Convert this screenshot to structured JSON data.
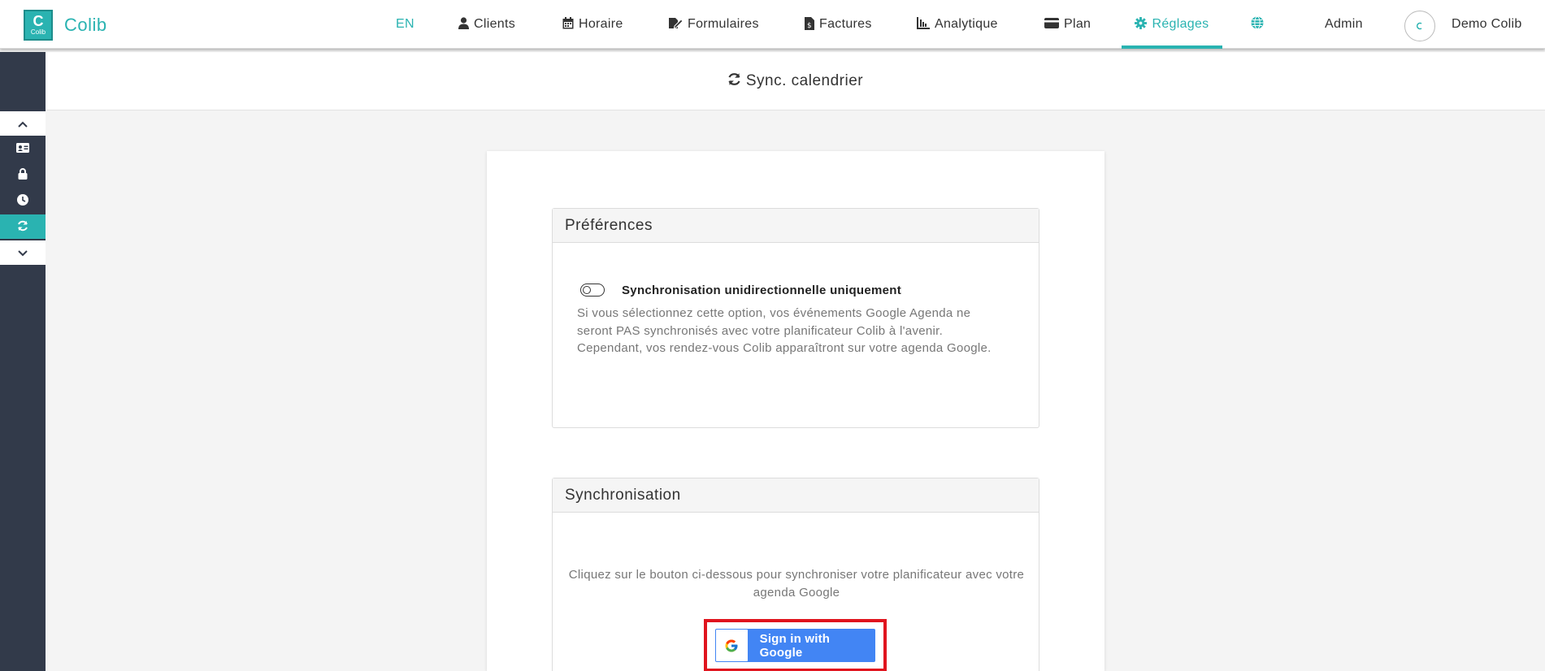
{
  "brand": {
    "logo_letter": "C",
    "logo_word": "Colib",
    "name": "Colib"
  },
  "nav": {
    "language": "EN",
    "items": [
      {
        "label": "Clients",
        "icon": "user-icon"
      },
      {
        "label": "Horaire",
        "icon": "calendar-icon"
      },
      {
        "label": "Formulaires",
        "icon": "form-edit-icon"
      },
      {
        "label": "Factures",
        "icon": "invoice-icon"
      },
      {
        "label": "Analytique",
        "icon": "chart-icon"
      },
      {
        "label": "Plan",
        "icon": "credit-card-icon"
      },
      {
        "label": "Réglages",
        "icon": "gear-icon",
        "active": true
      }
    ],
    "globe_icon": "globe-icon",
    "admin": "Admin",
    "user_name": "Demo Colib"
  },
  "sidebar": {
    "items": [
      "chevron-up-icon",
      "id-card-icon",
      "lock-icon",
      "clock-icon",
      "sync-icon",
      "chevron-down-icon"
    ],
    "active": "sync-icon"
  },
  "page": {
    "title": "Sync. calendrier",
    "title_icon": "sync-icon"
  },
  "preferences": {
    "heading": "Préférences",
    "toggle_label": "Synchronisation unidirectionnelle uniquement",
    "toggle_on": false,
    "description": "Si vous sélectionnez cette option, vos événements Google Agenda ne seront PAS synchronisés avec votre planificateur Colib à l'avenir. Cependant, vos rendez-vous Colib apparaîtront sur votre agenda Google."
  },
  "synchronisation": {
    "heading": "Synchronisation",
    "description": "Cliquez sur le bouton ci-dessous pour synchroniser votre planificateur avec votre agenda Google",
    "google_button_label": "Sign in with Google"
  },
  "colors": {
    "accent": "#2ab3b1",
    "sidebar": "#323a4a",
    "google_blue": "#4285f4",
    "highlight": "#e0141e"
  }
}
